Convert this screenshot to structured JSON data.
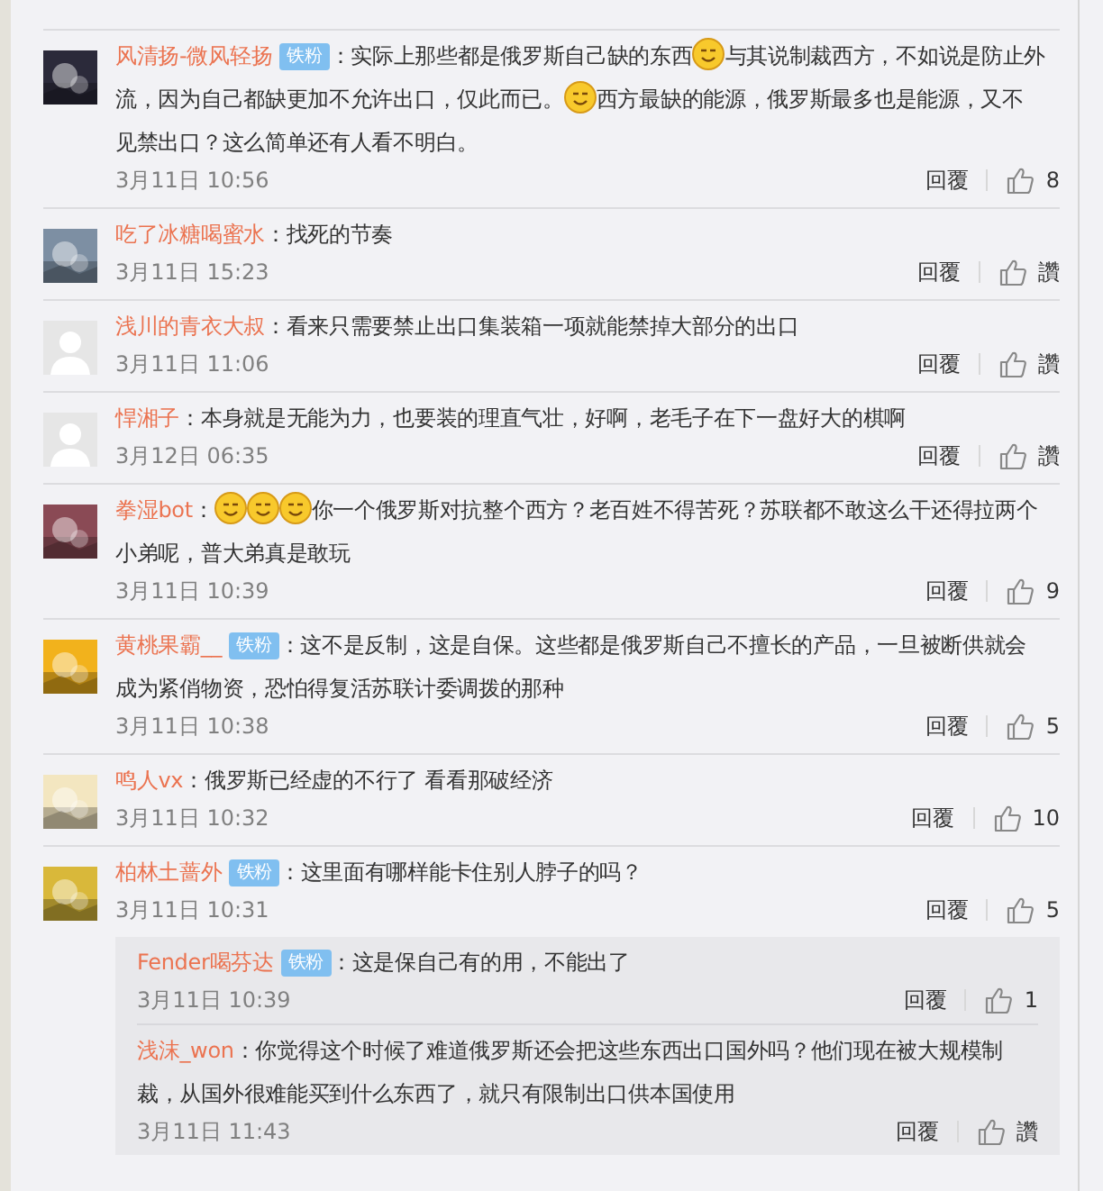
{
  "comments": [
    {
      "avatar": {
        "kind": "picture",
        "color": "#2b2a3a"
      },
      "username": "风清扬-微风轻扬",
      "badge": "铁粉",
      "content": [
        {
          "kind": "text",
          "text": "：实际上那些都是俄罗斯自己缺的东西"
        },
        {
          "kind": "emoji"
        },
        {
          "kind": "text",
          "text": "与其说制裁西方，不如说是防止外"
        },
        {
          "kind": "break"
        },
        {
          "kind": "text",
          "text": "流，因为自己都缺更加不允许出口，仅此而已。"
        },
        {
          "kind": "emoji"
        },
        {
          "kind": "text",
          "text": "西方最缺的能源，俄罗斯最多也是能源，又不"
        },
        {
          "kind": "break"
        },
        {
          "kind": "text",
          "text": "见禁出口？这么简单还有人看不明白。"
        }
      ],
      "time": "3月11日 10:56",
      "reply": "回覆",
      "likes": "8"
    },
    {
      "avatar": {
        "kind": "picture",
        "color": "#7d8fa3"
      },
      "username": "吃了冰糖喝蜜水",
      "content": [
        {
          "kind": "text",
          "text": "：找死的节奏"
        }
      ],
      "time": "3月11日 15:23",
      "reply": "回覆",
      "likes": "讚"
    },
    {
      "avatar": {
        "kind": "default"
      },
      "username": "浅川的青衣大叔",
      "content": [
        {
          "kind": "text",
          "text": "：看来只需要禁止出口集装箱一项就能禁掉大部分的出口"
        }
      ],
      "time": "3月11日 11:06",
      "reply": "回覆",
      "likes": "讚"
    },
    {
      "avatar": {
        "kind": "default"
      },
      "username": "悍湘子",
      "content": [
        {
          "kind": "text",
          "text": "：本身就是无能为力，也要装的理直气壮，好啊，老毛子在下一盘好大的棋啊"
        }
      ],
      "time": "3月12日 06:35",
      "reply": "回覆",
      "likes": "讚"
    },
    {
      "avatar": {
        "kind": "picture",
        "color": "#8a4a55"
      },
      "username": "拳湿bot",
      "content": [
        {
          "kind": "text",
          "text": "："
        },
        {
          "kind": "emoji"
        },
        {
          "kind": "emoji"
        },
        {
          "kind": "emoji"
        },
        {
          "kind": "text",
          "text": "你一个俄罗斯对抗整个西方？老百姓不得苦死？苏联都不敢这么干还得拉两个"
        },
        {
          "kind": "break"
        },
        {
          "kind": "text",
          "text": "小弟呢，普大弟真是敢玩"
        }
      ],
      "time": "3月11日 10:39",
      "reply": "回覆",
      "likes": "9"
    },
    {
      "avatar": {
        "kind": "picture",
        "color": "#f2b21c"
      },
      "username": "黄桃果霸__",
      "badge": "铁粉",
      "content": [
        {
          "kind": "text",
          "text": "：这不是反制，这是自保。这些都是俄罗斯自己不擅长的产品，一旦被断供就会"
        },
        {
          "kind": "break"
        },
        {
          "kind": "text",
          "text": "成为紧俏物资，恐怕得复活苏联计委调拨的那种"
        }
      ],
      "time": "3月11日 10:38",
      "reply": "回覆",
      "likes": "5"
    },
    {
      "avatar": {
        "kind": "picture",
        "color": "#f3e6c0"
      },
      "username": "鸣人vx",
      "content": [
        {
          "kind": "text",
          "text": "：俄罗斯已经虚的不行了 看看那破经济"
        }
      ],
      "time": "3月11日 10:32",
      "reply": "回覆",
      "likes": "10"
    },
    {
      "avatar": {
        "kind": "picture",
        "color": "#d9b83a"
      },
      "username": "柏林土蔷外",
      "badge": "铁粉",
      "content": [
        {
          "kind": "text",
          "text": "：这里面有哪样能卡住别人脖子的吗？"
        }
      ],
      "time": "3月11日 10:31",
      "reply": "回覆",
      "likes": "5",
      "replies": [
        {
          "username": "Fender喝芬达",
          "badge": "铁粉",
          "content": [
            {
              "kind": "text",
              "text": "：这是保自己有的用，不能出了"
            }
          ],
          "time": "3月11日 10:39",
          "reply": "回覆",
          "likes": "1"
        },
        {
          "username": "浅沫_won",
          "content": [
            {
              "kind": "text",
              "text": "：你觉得这个时候了难道俄罗斯还会把这些东西出口国外吗？他们现在被大规模制"
            },
            {
              "kind": "break"
            },
            {
              "kind": "text",
              "text": "裁，从国外很难能买到什么东西了，就只有限制出口供本国使用"
            }
          ],
          "time": "3月11日 11:43",
          "reply": "回覆",
          "likes": "讚"
        }
      ]
    }
  ]
}
